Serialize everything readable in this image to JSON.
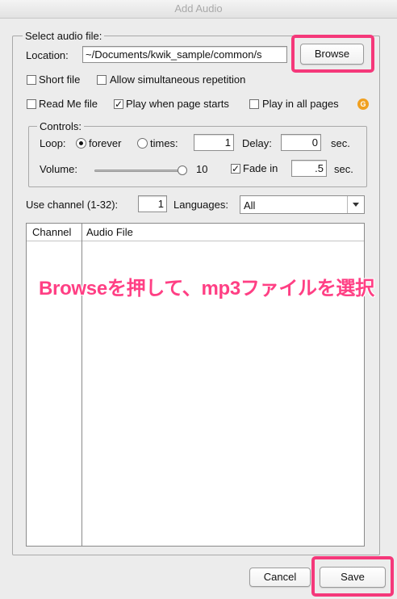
{
  "window": {
    "title": "Add Audio"
  },
  "file_section": {
    "legend": "Select audio file:",
    "location_label": "Location:",
    "location_value": "~/Documents/kwik_sample/common/s",
    "browse_label": "Browse"
  },
  "options": {
    "short_file": {
      "label": "Short file",
      "checked": false
    },
    "allow_repeat": {
      "label": "Allow simultaneous repetition",
      "checked": false
    },
    "read_me_file": {
      "label": "Read Me file",
      "checked": false
    },
    "play_on_start": {
      "label": "Play when page starts",
      "checked": true
    },
    "play_all_pages": {
      "label": "Play in all pages",
      "checked": false
    },
    "g_icon_text": "G"
  },
  "controls": {
    "legend": "Controls:",
    "loop_label": "Loop:",
    "forever_label": "forever",
    "times_label": "times:",
    "times_value": "1",
    "delay_label": "Delay:",
    "delay_value": "0",
    "delay_unit": "sec.",
    "volume_label": "Volume:",
    "volume_value": "10",
    "fade_label": "Fade in",
    "fade_checked": true,
    "fade_value": ".5",
    "fade_unit": "sec."
  },
  "channel": {
    "label": "Use channel (1-32):",
    "value": "1",
    "languages_label": "Languages:",
    "languages_value": "All"
  },
  "table": {
    "columns": [
      "Channel",
      "Audio File"
    ],
    "rows": []
  },
  "annotation": "Browseを押して、mp3ファイルを選択",
  "footer": {
    "cancel_label": "Cancel",
    "save_label": "Save"
  },
  "colors": {
    "highlight": "#f5387a",
    "annotation": "#ff3f84",
    "icon_g": "#f0a020"
  }
}
